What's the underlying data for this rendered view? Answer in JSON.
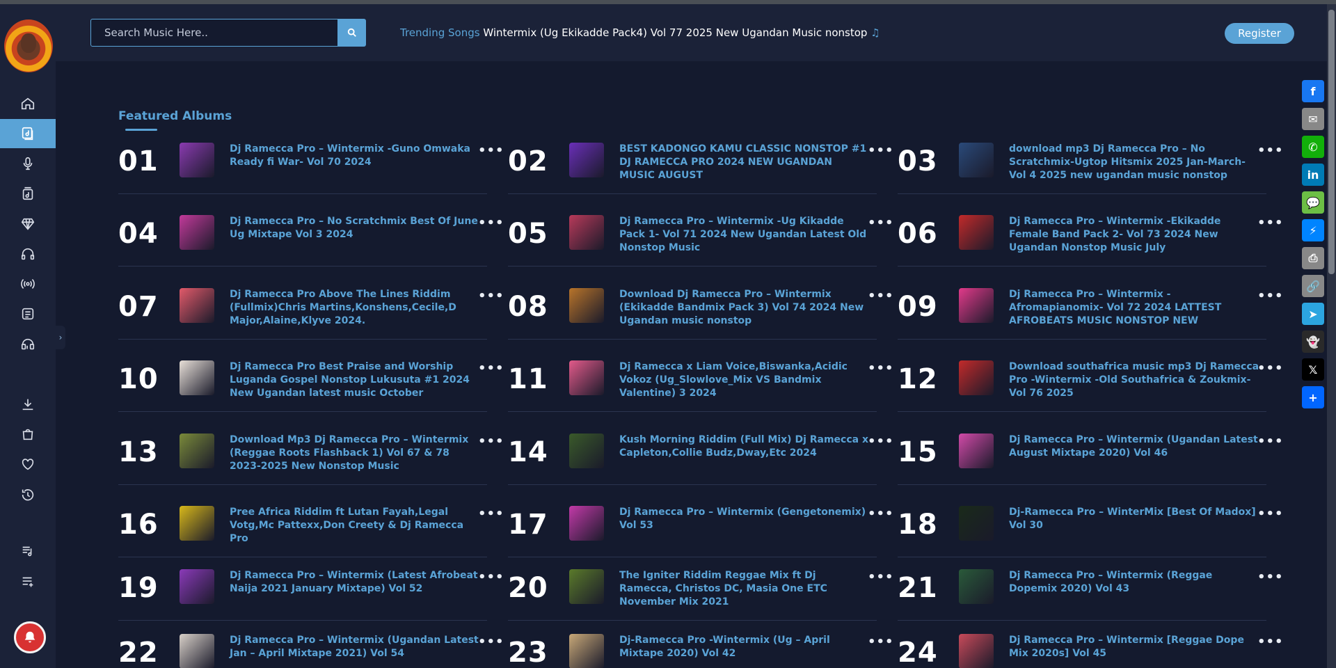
{
  "header": {
    "search_placeholder": "Search Music Here..",
    "trending_label": "Trending Songs",
    "trending_song": "Wintermix (Ug Ekikadde Pack4) Vol 77 2025 New Ugandan Music nonstop",
    "trending_note": "♫",
    "register_label": "Register"
  },
  "main": {
    "section_title": "Featured Albums",
    "more_glyph": "•••",
    "albums": [
      {
        "num": "01",
        "title": "Dj Ramecca Pro – Wintermix -Guno Omwaka Ready fi War- Vol 70 2024",
        "color": "#8a3bb0"
      },
      {
        "num": "02",
        "title": "BEST KADONGO KAMU CLASSIC NONSTOP #1 DJ RAMECCA PRO 2024 NEW UGANDAN MUSIC AUGUST",
        "color": "#6a2fb8"
      },
      {
        "num": "03",
        "title": "download mp3 Dj Ramecca Pro – No Scratchmix-Ugtop Hitsmix 2025 Jan-March-Vol 4 2025 new ugandan music nonstop",
        "color": "#2a4a7a"
      },
      {
        "num": "04",
        "title": "Dj Ramecca Pro – No Scratchmix Best Of June Ug Mixtape Vol 3 2024",
        "color": "#c23a9a"
      },
      {
        "num": "05",
        "title": "Dj Ramecca Pro – Wintermix -Ug Kikadde Pack 1- Vol 71 2024 New Ugandan Latest Old Nonstop Music",
        "color": "#b83a5a"
      },
      {
        "num": "06",
        "title": "Dj Ramecca Pro – Wintermix -Ekikadde Female Band Pack 2- Vol 73 2024 New Ugandan Nonstop Music July",
        "color": "#c22a2a"
      },
      {
        "num": "07",
        "title": "Dj Ramecca Pro Above The Lines Riddim (Fullmix)Chris Martins,Konshens,Cecile,D Major,Alaine,Klyve 2024.",
        "color": "#e25a6a"
      },
      {
        "num": "08",
        "title": "Download Dj Ramecca Pro – Wintermix (Ekikadde Bandmix Pack 3) Vol 74 2024 New Ugandan music nonstop",
        "color": "#b8742a"
      },
      {
        "num": "09",
        "title": "Dj Ramecca Pro – Wintermix -Afromapianomix- Vol 72 2024 LATTEST AFROBEATS MUSIC NONSTOP NEW",
        "color": "#e23a8a"
      },
      {
        "num": "10",
        "title": "Dj Ramecca Pro Best Praise and Worship Luganda Gospel Nonstop Lukusuta #1 2024 New Ugandan latest music October",
        "color": "#e8e0d8"
      },
      {
        "num": "11",
        "title": "Dj Ramecca x Liam Voice,Biswanka,Acidic Vokoz (Ug_Slowlove_Mix VS Bandmix Valentine) 3 2024",
        "color": "#e25a8a"
      },
      {
        "num": "12",
        "title": "Download southafrica music mp3 Dj Ramecca Pro -Wintermix -Old Southafrica & Zoukmix- Vol 76 2025",
        "color": "#c22a2a"
      },
      {
        "num": "13",
        "title": "Download Mp3 Dj Ramecca Pro – Wintermix (Reggae Roots Flashback 1) Vol 67 & 78 2023-2025 New Nonstop Music",
        "color": "#7a8a3a"
      },
      {
        "num": "14",
        "title": "Kush Morning Riddim (Full Mix) Dj Ramecca x Capleton,Collie Budz,Dway,Etc 2024",
        "color": "#3a5a2a"
      },
      {
        "num": "15",
        "title": "Dj Ramecca Pro – Wintermix (Ugandan Latest August Mixtape 2020) Vol 46",
        "color": "#d24aa8"
      },
      {
        "num": "16",
        "title": "Pree Africa Riddim ft Lutan Fayah,Legal Votg,Mc Pattexx,Don Creety & Dj Ramecca Pro",
        "color": "#d8b81a"
      },
      {
        "num": "17",
        "title": "Dj Ramecca Pro – Wintermix (Gengetonemix) Vol 53",
        "color": "#c23aa8"
      },
      {
        "num": "18",
        "title": "Dj-Ramecca Pro – WinterMix [Best Of Madox] Vol 30",
        "color": "#1a2a1a"
      },
      {
        "num": "19",
        "title": "Dj Ramecca Pro – Wintermix (Latest Afrobeat Naija 2021 January Mixtape) Vol 52",
        "color": "#8a3ab8"
      },
      {
        "num": "20",
        "title": "The Igniter Riddim Reggae Mix ft Dj Ramecca, Christos DC, Masia One ETC November Mix 2021",
        "color": "#5a7a2a"
      },
      {
        "num": "21",
        "title": "Dj Ramecca Pro – Wintermix (Reggae Dopemix 2020) Vol 43",
        "color": "#2a5a3a"
      },
      {
        "num": "22",
        "title": "Dj Ramecca Pro – Wintermix (Ugandan Latest Jan – April Mixtape 2021) Vol 54",
        "color": "#d8d0c8"
      },
      {
        "num": "23",
        "title": "Dj-Ramecca Pro -Wintermix (Ug – April Mixtape 2020) Vol 42",
        "color": "#c8a878"
      },
      {
        "num": "24",
        "title": "Dj Ramecca Pro – Wintermix [Reggae Dope Mix 2020s] Vol 45",
        "color": "#c84a5a"
      }
    ]
  },
  "sidebar": {
    "icons": [
      "home-icon",
      "music-library-icon",
      "microphone-icon",
      "album-icon",
      "diamond-icon",
      "headphones-icon",
      "radio-icon",
      "news-icon",
      "music-tag-icon",
      "download-icon",
      "shopping-bag-icon",
      "heart-icon",
      "history-icon",
      "playlist-icon",
      "add-playlist-icon"
    ],
    "active_index": 1
  },
  "share": [
    {
      "name": "facebook",
      "color": "#1877f2",
      "glyph": "f"
    },
    {
      "name": "email",
      "color": "#888888",
      "glyph": "✉"
    },
    {
      "name": "whatsapp",
      "color": "#12af0a",
      "glyph": "✆"
    },
    {
      "name": "linkedin",
      "color": "#007bb5",
      "glyph": "in"
    },
    {
      "name": "sms",
      "color": "#6cbe45",
      "glyph": "💬"
    },
    {
      "name": "messenger",
      "color": "#0084ff",
      "glyph": "⚡"
    },
    {
      "name": "print",
      "color": "#888888",
      "glyph": "⎙"
    },
    {
      "name": "copy-link",
      "color": "#888888",
      "glyph": "🔗"
    },
    {
      "name": "telegram",
      "color": "#2ca5e0",
      "glyph": "➤"
    },
    {
      "name": "snapchat",
      "color": "#2a2a2a",
      "glyph": "👻"
    },
    {
      "name": "x",
      "color": "#000000",
      "glyph": "𝕏"
    },
    {
      "name": "share-more",
      "color": "#0166ff",
      "glyph": "+"
    }
  ]
}
